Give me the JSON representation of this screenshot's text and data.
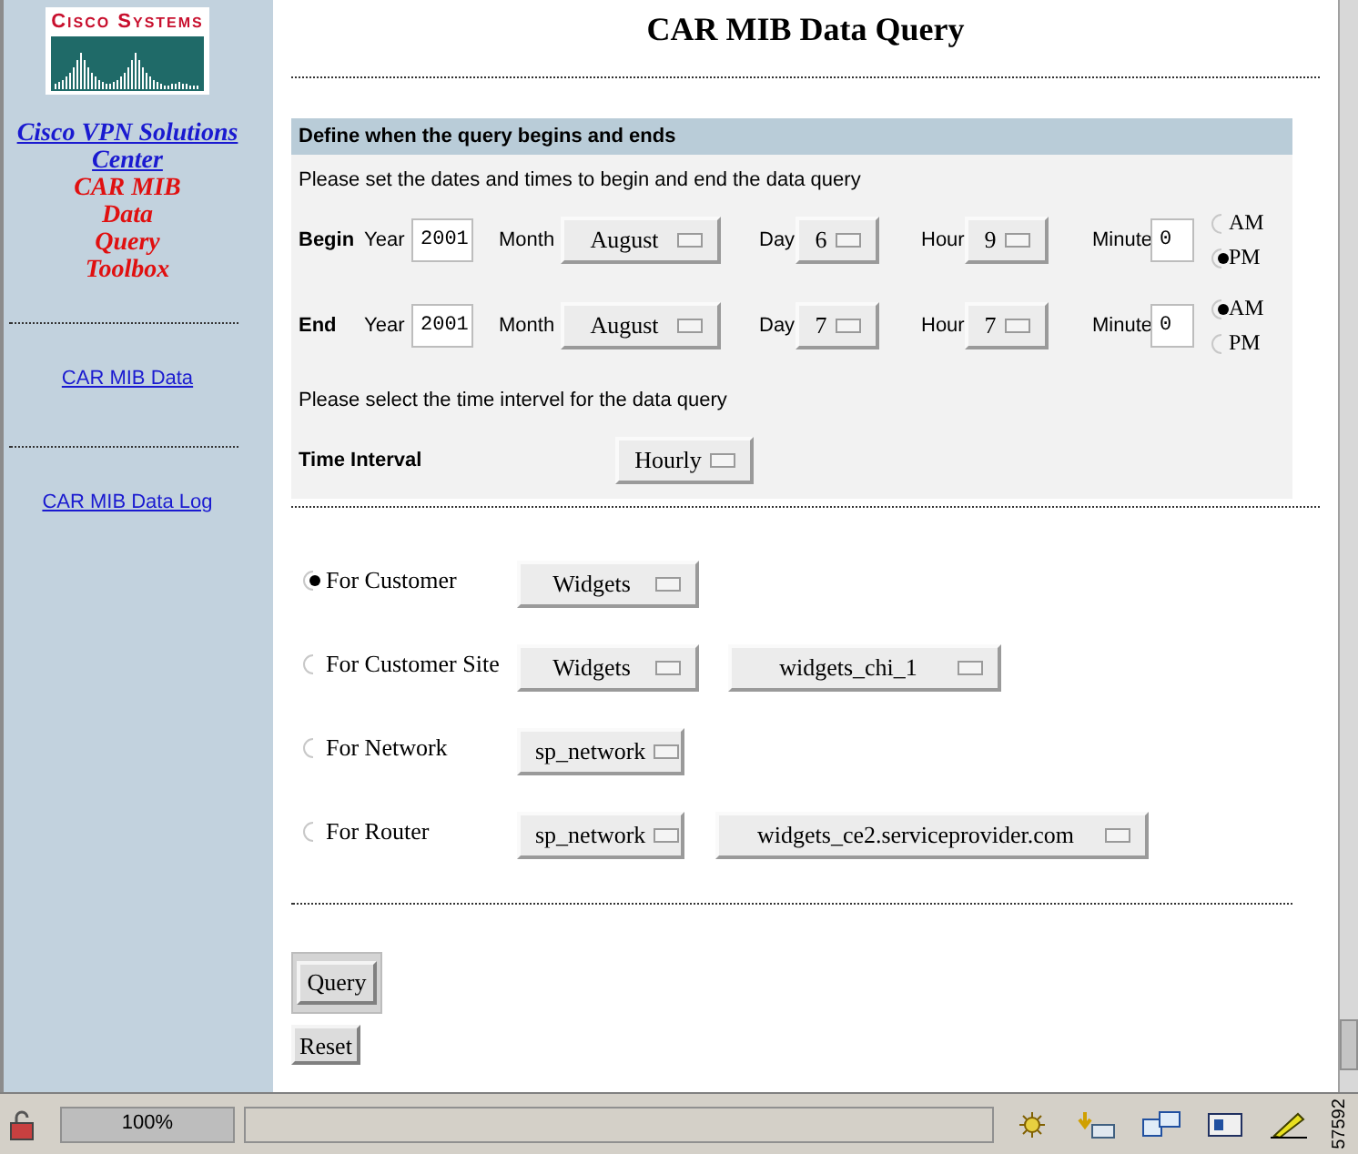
{
  "sidebar": {
    "logo_text": "Cisco Systems",
    "title_links": [
      "Cisco VPN Solutions",
      "Center"
    ],
    "subtitle": [
      "CAR MIB",
      "Data",
      "Query",
      "Toolbox"
    ],
    "links": [
      "CAR MIB Data",
      "CAR MIB Data Log"
    ]
  },
  "page_title": "CAR MIB Data Query",
  "query_window": {
    "heading": "Define when the query begins and ends",
    "instruction": "Please set the dates and times to begin and end the data query",
    "rows": [
      {
        "label": "Begin",
        "year_label": "Year",
        "year": "2001",
        "month_label": "Month",
        "month": "August",
        "day_label": "Day",
        "day": "6",
        "hour_label": "Hour",
        "hour": "9",
        "minute_label": "Minute",
        "minute": "0",
        "ampm": [
          {
            "label": "AM",
            "selected": false
          },
          {
            "label": "PM",
            "selected": true
          }
        ]
      },
      {
        "label": "End",
        "year_label": "Year",
        "year": "2001",
        "month_label": "Month",
        "month": "August",
        "day_label": "Day",
        "day": "7",
        "hour_label": "Hour",
        "hour": "7",
        "minute_label": "Minute",
        "minute": "0",
        "ampm": [
          {
            "label": "AM",
            "selected": true
          },
          {
            "label": "PM",
            "selected": false
          }
        ]
      }
    ],
    "interval_instruction": "Please select the time intervel for the data query",
    "interval_label": "Time Interval",
    "interval": "Hourly"
  },
  "scope": [
    {
      "label": "For Customer",
      "selected": true,
      "selects": [
        "Widgets"
      ]
    },
    {
      "label": "For Customer Site",
      "selected": false,
      "selects": [
        "Widgets",
        "widgets_chi_1"
      ]
    },
    {
      "label": "For Network",
      "selected": false,
      "selects": [
        "sp_network"
      ]
    },
    {
      "label": "For Router",
      "selected": false,
      "selects": [
        "sp_network",
        "widgets_ce2.serviceprovider.com"
      ]
    }
  ],
  "buttons": [
    "Query",
    "Reset"
  ],
  "status_bar": {
    "zoom": "100%"
  },
  "figure_number": "57592"
}
